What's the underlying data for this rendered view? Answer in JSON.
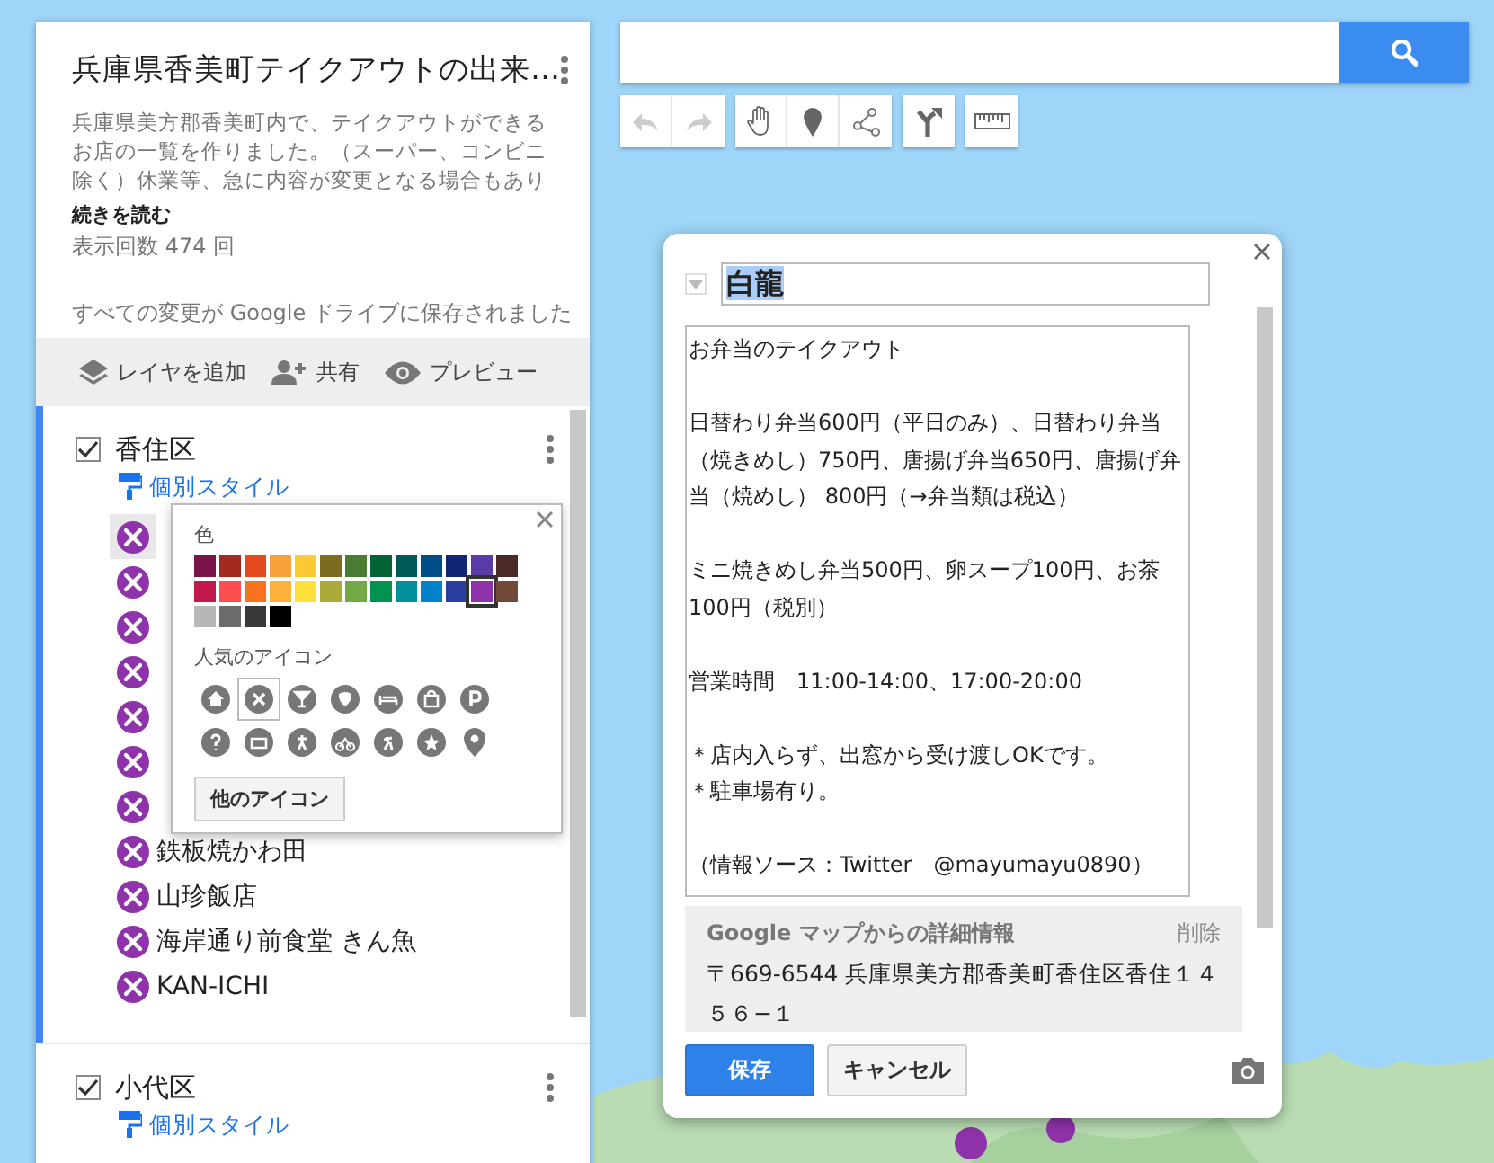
{
  "map_info": {
    "title": "兵庫県香美町テイクアウトの出来…",
    "description": "兵庫県美方郡香美町内で、テイクアウトができるお店の一覧を作りました。（スーパー、コンビニ除く）休業等、急に内容が変更となる場合もあり",
    "read_more": "続きを読む",
    "views": "表示回数 474 回",
    "save_status": "すべての変更が Google ドライブに保存されました"
  },
  "toolbar": [
    {
      "kind": "layers",
      "label": "レイヤを追加"
    },
    {
      "kind": "share",
      "label": "共有"
    },
    {
      "kind": "preview",
      "label": "プレビュー"
    }
  ],
  "layers": [
    {
      "name": "香住区",
      "checked": true,
      "active": true,
      "style_link": "個別スタイル",
      "items": [
        {
          "selected": true
        },
        {
          "selected": false
        },
        {
          "selected": false
        },
        {
          "selected": false
        },
        {
          "selected": false
        },
        {
          "selected": false
        },
        {
          "selected": false
        },
        {
          "label": "鉄板焼かわ田",
          "selected": false
        },
        {
          "label": "山珍飯店",
          "selected": false
        },
        {
          "label": "海岸通り前食堂 きん魚",
          "selected": false
        },
        {
          "label": "KAN-ICHI",
          "selected": false
        }
      ]
    },
    {
      "name": "小代区",
      "checked": true,
      "active": false,
      "style_link": "個別スタイル"
    }
  ],
  "style_popup": {
    "color_label": "色",
    "colors": [
      {
        "color": "#7b1448",
        "selected": false
      },
      {
        "color": "#a32a1f",
        "selected": false
      },
      {
        "color": "#e44a1e",
        "selected": false
      },
      {
        "color": "#f8a03a",
        "selected": false
      },
      {
        "color": "#fbc935",
        "selected": false
      },
      {
        "color": "#7d6c1f",
        "selected": false
      },
      {
        "color": "#4a7c31",
        "selected": false
      },
      {
        "color": "#006434",
        "selected": false
      },
      {
        "color": "#005a5a",
        "selected": false
      },
      {
        "color": "#004d8a",
        "selected": false
      },
      {
        "color": "#102675",
        "selected": false
      },
      {
        "color": "#5a3ca8",
        "selected": false
      },
      {
        "color": "#4a2a24",
        "selected": false
      },
      {
        "color": "#c2194c",
        "selected": false
      },
      {
        "color": "#fd4f50",
        "selected": false
      },
      {
        "color": "#f7731f",
        "selected": false
      },
      {
        "color": "#fbb23a",
        "selected": false
      },
      {
        "color": "#fde13a",
        "selected": false
      },
      {
        "color": "#aba93a",
        "selected": false
      },
      {
        "color": "#74a946",
        "selected": false
      },
      {
        "color": "#00924f",
        "selected": false
      },
      {
        "color": "#00909c",
        "selected": false
      },
      {
        "color": "#0182c8",
        "selected": false
      },
      {
        "color": "#2b3fa0",
        "selected": false
      },
      {
        "color": "#8e33a9",
        "selected": true
      },
      {
        "color": "#704939",
        "selected": false
      },
      {
        "color": "#b7b7b7",
        "selected": false
      },
      {
        "color": "#6b6b6b",
        "selected": false
      },
      {
        "color": "#383838",
        "selected": false
      },
      {
        "color": "#000000",
        "selected": false
      }
    ],
    "icons_label": "人気のアイコン",
    "icons": [
      {
        "selected": false
      },
      {
        "selected": true
      },
      {
        "selected": false
      },
      {
        "selected": false
      },
      {
        "selected": false
      },
      {
        "selected": false
      },
      {
        "selected": false
      },
      {
        "selected": false
      },
      {
        "selected": false
      },
      {
        "selected": false
      },
      {
        "selected": false
      },
      {
        "selected": false
      },
      {
        "selected": false
      },
      {
        "selected": false
      }
    ],
    "more_button": "他のアイコン"
  },
  "edit_dialog": {
    "title": "白龍",
    "description": [
      [
        "お弁当のテイクアウト"
      ],
      [
        "日替わり弁当600円（平日のみ）、日替わり弁当（焼きめし）750円、唐揚げ弁当650円、唐揚げ弁当（焼めし） 800円（→弁当類は税込）"
      ],
      [
        "ミニ焼きめし弁当500円、卵スープ100円、お茶100円（税別）"
      ],
      [
        "営業時間　11:00-14:00、17:00-20:00"
      ],
      [
        "＊店内入らず、出窓から受け渡しOKです。",
        "＊駐車場有り。"
      ],
      [
        "（情報ソース：Twitter　@mayumayu0890）"
      ]
    ],
    "details_heading": "Google マップからの詳細情報",
    "delete": "削除",
    "address": "〒669-6544 兵庫県美方郡香美町香住区香住１４５６−１",
    "save": "保存",
    "cancel": "キャンセル"
  }
}
